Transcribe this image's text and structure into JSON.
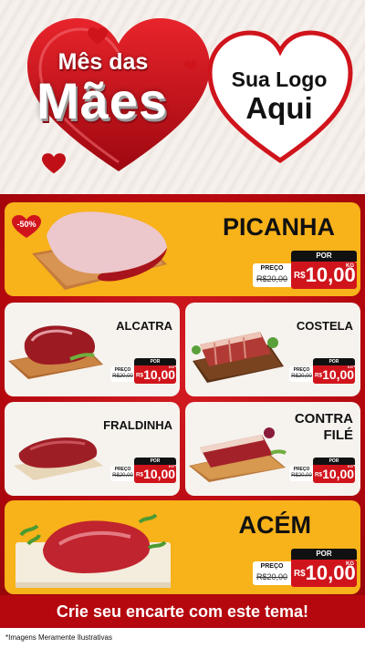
{
  "header": {
    "title_line1": "Mês das",
    "title_line2": "Mães",
    "logo_line1": "Sua Logo",
    "logo_line2": "Aqui"
  },
  "colors": {
    "red": "#d0141c",
    "dark_red": "#b5070e",
    "yellow": "#f8b21a",
    "black": "#111111",
    "white": "#ffffff"
  },
  "products": [
    {
      "name": "PICANHA",
      "badge": "-50%",
      "label_old": "PREÇO",
      "old_price": "R$20,00",
      "label_new": "POR",
      "currency": "R$",
      "new_price": "10,00",
      "unit": "KG",
      "image": "picanha-meat"
    },
    {
      "name": "ALCATRA",
      "label_old": "PREÇO",
      "old_price": "R$20,00",
      "label_new": "POR",
      "currency": "R$",
      "new_price": "10,00",
      "unit": "KG",
      "image": "alcatra-meat"
    },
    {
      "name": "COSTELA",
      "label_old": "PREÇO",
      "old_price": "R$20,00",
      "label_new": "POR",
      "currency": "R$",
      "new_price": "10,00",
      "unit": "KG",
      "image": "costela-meat"
    },
    {
      "name": "FRALDINHA",
      "label_old": "PREÇO",
      "old_price": "R$20,00",
      "label_new": "POR",
      "currency": "R$",
      "new_price": "10,00",
      "unit": "KG",
      "image": "fraldinha-meat"
    },
    {
      "name_line1": "CONTRA",
      "name_line2": "FILÉ",
      "label_old": "PREÇO",
      "old_price": "R$20,00",
      "label_new": "POR",
      "currency": "R$",
      "new_price": "10,00",
      "unit": "KG",
      "image": "contra-file-meat"
    },
    {
      "name": "ACÉM",
      "label_old": "PREÇO",
      "old_price": "R$20,00",
      "label_new": "POR",
      "currency": "R$",
      "new_price": "10,00",
      "unit": "KG",
      "image": "acem-meat"
    }
  ],
  "footer": {
    "banner": "Crie seu encarte com este tema!",
    "footnote": "*Imagens Meramente Ilustrativas"
  }
}
